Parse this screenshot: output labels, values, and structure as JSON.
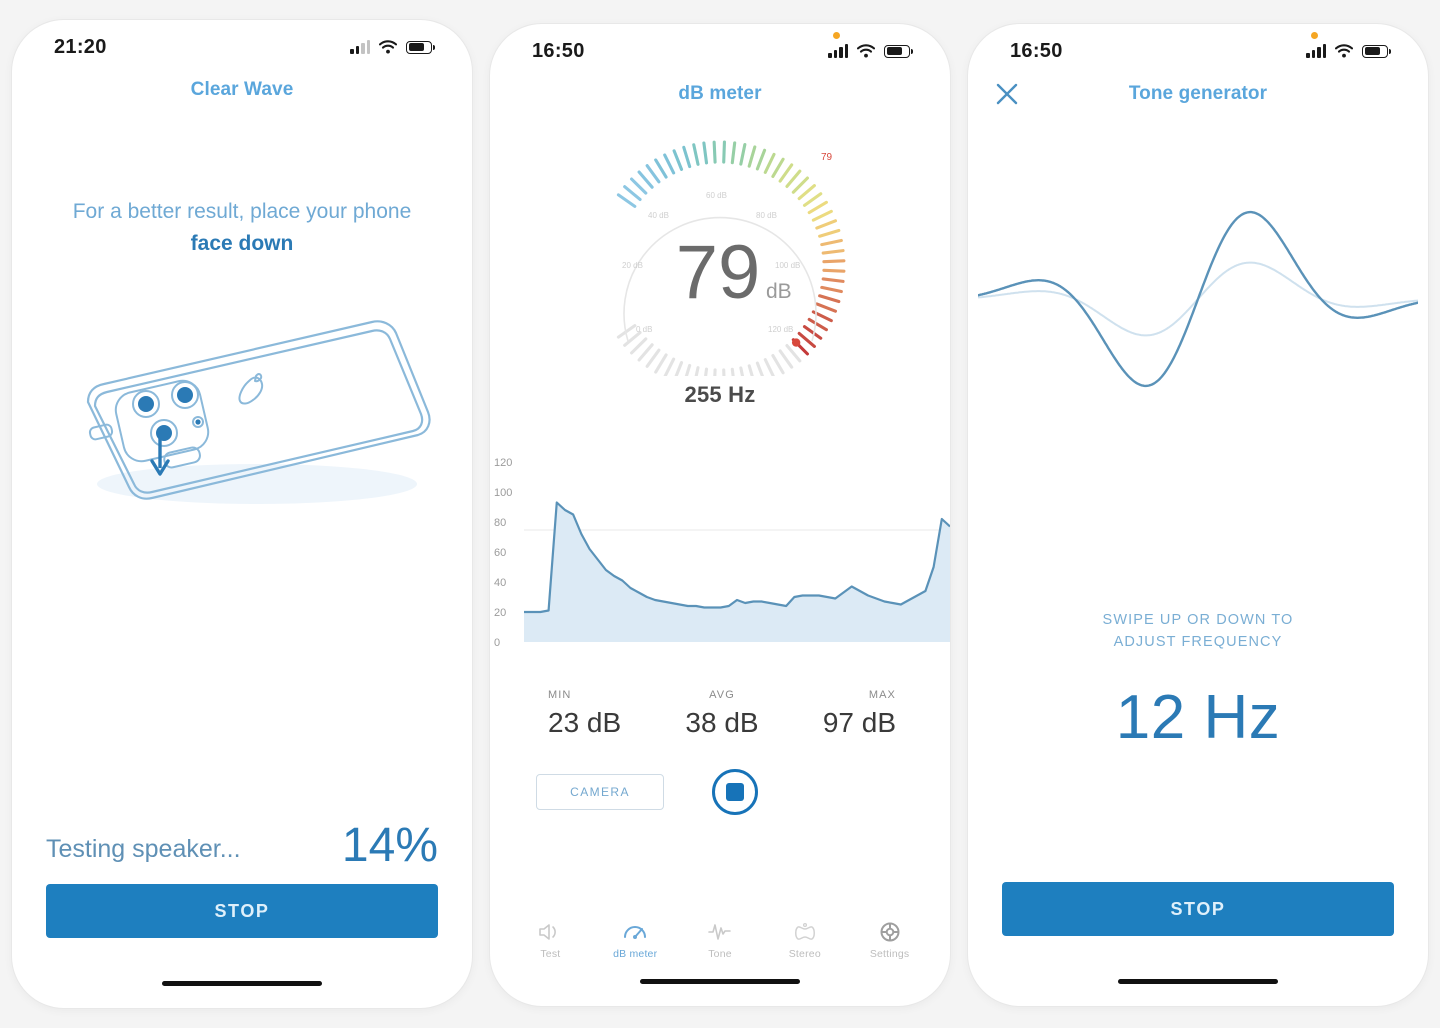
{
  "accent": {
    "blue": "#1e7fbf",
    "light_blue": "#5aa6dc",
    "muted_blue": "#6fa9d4",
    "grey_text": "#4b4b4b",
    "record_orange": "#f5a623"
  },
  "screen1": {
    "status": {
      "time": "21:20",
      "signal_icon": "cellular-bars-icon",
      "wifi_icon": "wifi-icon",
      "battery_icon": "battery-icon"
    },
    "nav": {
      "title": "Clear Wave"
    },
    "hint": {
      "line1": "For a better result, place your phone",
      "line2": "face down"
    },
    "illustration": {
      "name": "phone-face-down-illustration",
      "arrow": "down-arrow-icon"
    },
    "progress": {
      "label": "Testing speaker...",
      "percent": "14%",
      "value": 14
    },
    "button": {
      "label": "STOP"
    }
  },
  "screen2": {
    "status": {
      "time": "16:50",
      "signal_icon": "cellular-bars-icon",
      "wifi_icon": "wifi-icon",
      "battery_icon": "battery-icon",
      "recording_dot": true
    },
    "nav": {
      "title": "dB meter"
    },
    "gauge": {
      "value": "79",
      "unit": "dB",
      "needle_label": "79",
      "min": 0,
      "max": 120,
      "scale_labels": [
        "0 dB",
        "20 dB",
        "40 dB",
        "60 dB",
        "80 dB",
        "100 dB",
        "120 dB"
      ]
    },
    "frequency": "255 Hz",
    "stats": [
      {
        "key": "MIN",
        "value": "23 dB"
      },
      {
        "key": "AVG",
        "value": "38 dB"
      },
      {
        "key": "MAX",
        "value": "97 dB"
      }
    ],
    "controls": {
      "camera_label": "CAMERA",
      "record_button": "stop-record-button"
    },
    "tabs": [
      {
        "label": "Test",
        "icon": "speaker-test-icon",
        "active": false
      },
      {
        "label": "dB meter",
        "icon": "gauge-icon",
        "active": true
      },
      {
        "label": "Tone",
        "icon": "tone-wave-icon",
        "active": false
      },
      {
        "label": "Stereo",
        "icon": "stereo-icon",
        "active": false
      },
      {
        "label": "Settings",
        "icon": "settings-gear-icon",
        "active": false
      }
    ]
  },
  "screen3": {
    "status": {
      "time": "16:50",
      "signal_icon": "cellular-bars-icon",
      "wifi_icon": "wifi-icon",
      "battery_icon": "battery-icon",
      "recording_dot": true
    },
    "nav": {
      "title": "Tone generator",
      "close_icon": "close-x-icon"
    },
    "waveform": {
      "name": "gaussian-tone-waveform"
    },
    "swipe_hint_line1": "SWIPE UP OR DOWN TO",
    "swipe_hint_line2": "ADJUST FREQUENCY",
    "frequency": "12 Hz",
    "button": {
      "label": "STOP"
    }
  },
  "chart_data": {
    "type": "area",
    "title": "",
    "xlabel": "",
    "ylabel": "",
    "ylim": [
      0,
      120
    ],
    "yticks": [
      0,
      20,
      40,
      60,
      80,
      100,
      120
    ],
    "ytick_labels": [
      "0",
      "20",
      "40",
      "60",
      "80",
      "100",
      "120"
    ],
    "grid": false,
    "threshold_line": 78,
    "series": [
      {
        "name": "dB level",
        "color": "#5a92b8",
        "fill": "#dceaf5",
        "values": [
          20,
          20,
          20,
          21,
          93,
          88,
          85,
          72,
          62,
          55,
          48,
          44,
          41,
          36,
          33,
          30,
          28,
          27,
          26,
          25,
          24,
          24,
          23,
          23,
          23,
          24,
          28,
          26,
          27,
          27,
          26,
          25,
          24,
          30,
          31,
          31,
          31,
          30,
          29,
          33,
          37,
          34,
          31,
          29,
          27,
          26,
          25,
          28,
          31,
          34,
          50,
          82,
          77
        ]
      }
    ]
  }
}
